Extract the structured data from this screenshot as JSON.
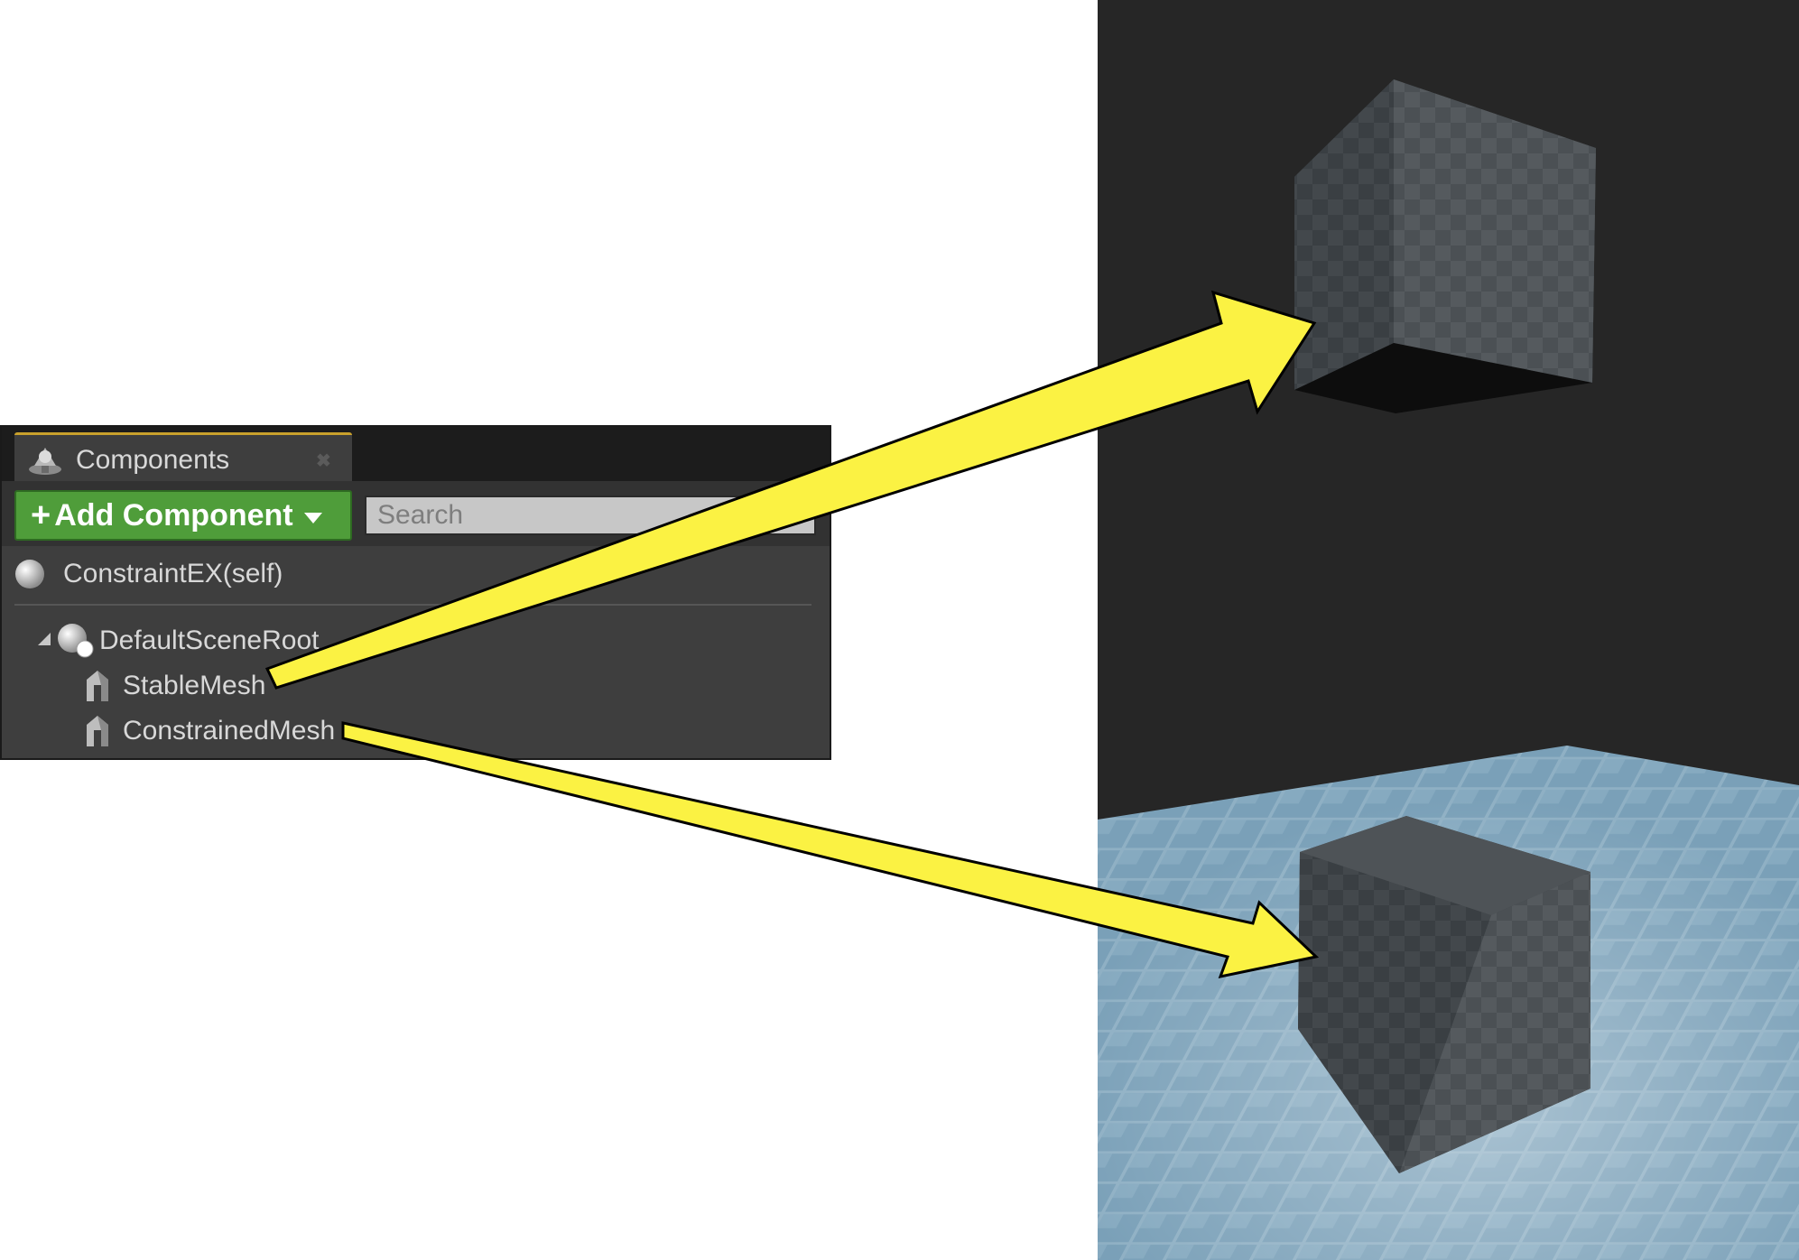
{
  "panel": {
    "tab_label": "Components",
    "tab_icon": "components-icon",
    "close_icon": "close-icon",
    "add_button_label": "Add Component",
    "add_icon": "plus-icon",
    "dropdown_icon": "chevron-down-icon",
    "search_placeholder": "Search",
    "search_value": ""
  },
  "tree": {
    "self_item": "ConstraintEX(self)",
    "root_item": "DefaultSceneRoot",
    "children": [
      "StableMesh",
      "ConstrainedMesh"
    ]
  },
  "viewport": {
    "objects": [
      "floating-cube",
      "grounded-cube",
      "tiled-floor"
    ]
  },
  "colors": {
    "panel_bg": "#3e3e3e",
    "add_button": "#4f9d3a",
    "arrow": "#fbf243",
    "viewport_bg": "#262626"
  }
}
